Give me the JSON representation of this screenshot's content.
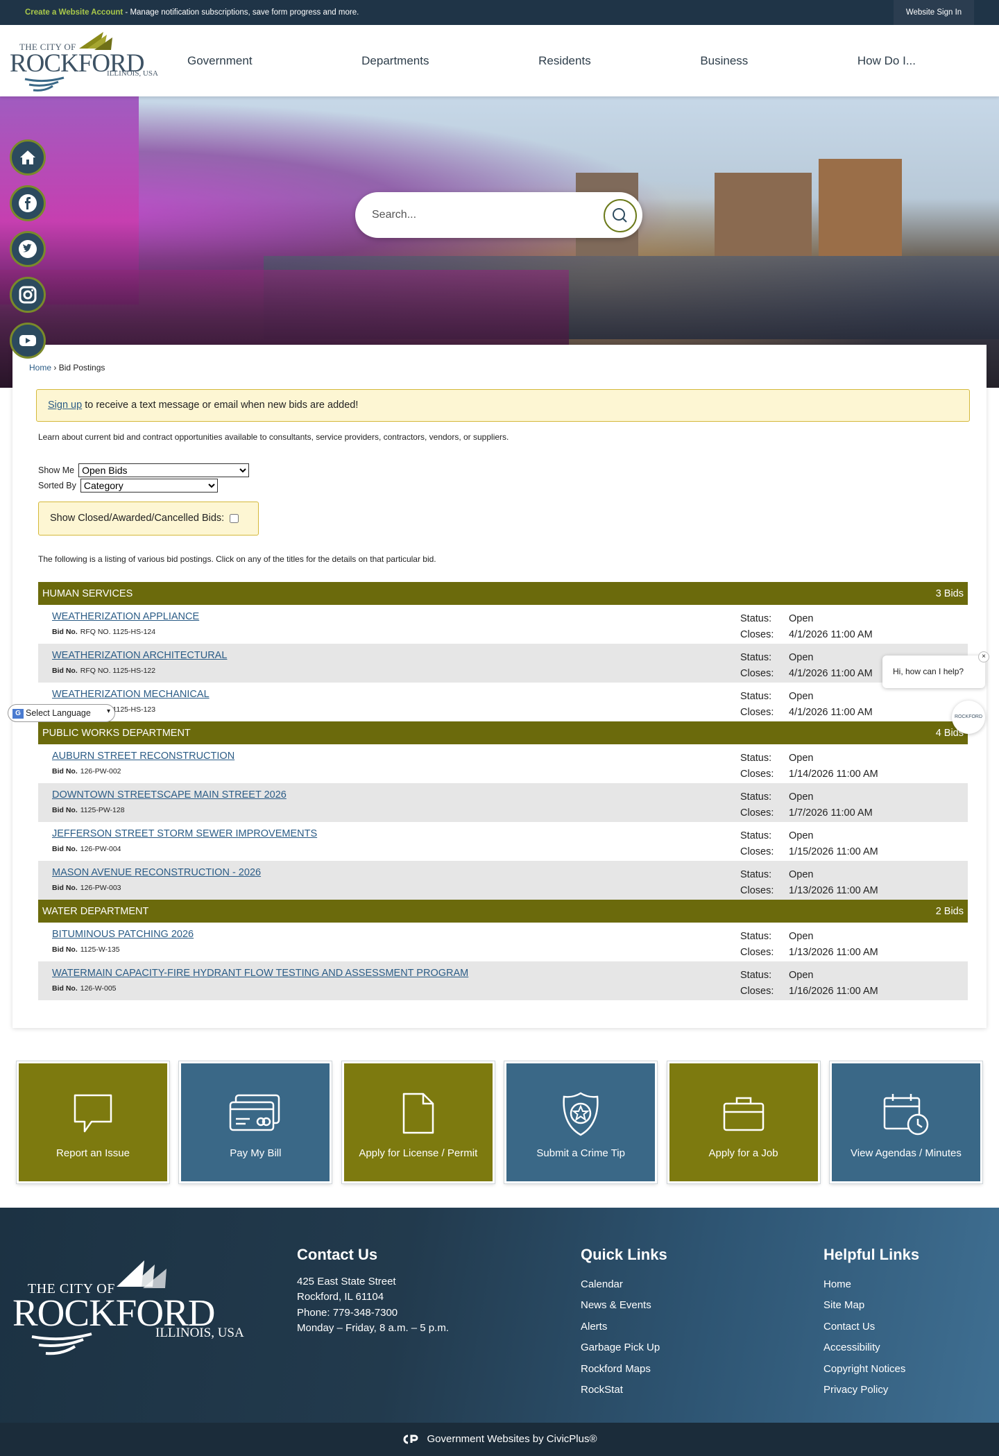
{
  "topbar": {
    "create_link": "Create a Website Account",
    "message": " - Manage notification subscriptions, save form progress and more.",
    "sign_in": "Website Sign In"
  },
  "logo": {
    "line1": "THE CITY OF",
    "line2": "ROCKFORD",
    "line3": "ILLINOIS, USA"
  },
  "nav": [
    "Government",
    "Departments",
    "Residents",
    "Business",
    "How Do I..."
  ],
  "search": {
    "placeholder": "Search..."
  },
  "social": [
    "home-icon",
    "facebook-icon",
    "twitter-icon",
    "instagram-icon",
    "youtube-icon"
  ],
  "breadcrumb": {
    "home": "Home",
    "separator": " › ",
    "current": "Bid Postings"
  },
  "alert": {
    "link": "Sign up",
    "text": " to receive a text message or email when new bids are added!"
  },
  "intro": "Learn about current bid and contract opportunities available to consultants, service providers, contractors, vendors, or suppliers.",
  "filters": {
    "show_me_label": "Show Me",
    "show_me_value": "Open Bids",
    "sorted_by_label": "Sorted By",
    "sorted_by_value": "Category",
    "closed_label": "Show Closed/Awarded/Cancelled Bids:"
  },
  "list_intro": "The following is a listing of various bid postings. Click on any of the titles for the details on that particular bid.",
  "labels": {
    "bid_no": "Bid No.",
    "status": "Status:",
    "closes": "Closes:"
  },
  "categories": [
    {
      "name": "HUMAN SERVICES",
      "count": "3 Bids",
      "bids": [
        {
          "title": "WEATHERIZATION APPLIANCE",
          "bid_no": "RFQ NO. 1125-HS-124",
          "status": "Open",
          "closes": "4/1/2026 11:00 AM"
        },
        {
          "title": "WEATHERIZATION ARCHITECTURAL",
          "bid_no": "RFQ NO. 1125-HS-122",
          "status": "Open",
          "closes": "4/1/2026 11:00 AM"
        },
        {
          "title": "WEATHERIZATION MECHANICAL",
          "bid_no": "RFQ NO. 1125-HS-123",
          "status": "Open",
          "closes": "4/1/2026 11:00 AM"
        }
      ]
    },
    {
      "name": "PUBLIC WORKS DEPARTMENT",
      "count": "4 Bids",
      "bids": [
        {
          "title": "AUBURN STREET RECONSTRUCTION",
          "bid_no": "126-PW-002",
          "status": "Open",
          "closes": "1/14/2026 11:00 AM"
        },
        {
          "title": "DOWNTOWN STREETSCAPE MAIN STREET 2026",
          "bid_no": "1125-PW-128",
          "status": "Open",
          "closes": "1/7/2026 11:00 AM"
        },
        {
          "title": "JEFFERSON STREET STORM SEWER IMPROVEMENTS",
          "bid_no": "126-PW-004",
          "status": "Open",
          "closes": "1/15/2026 11:00 AM"
        },
        {
          "title": "MASON AVENUE RECONSTRUCTION - 2026",
          "bid_no": "126-PW-003",
          "status": "Open",
          "closes": "1/13/2026 11:00 AM"
        }
      ]
    },
    {
      "name": "WATER DEPARTMENT",
      "count": "2 Bids",
      "bids": [
        {
          "title": "BITUMINOUS PATCHING 2026",
          "bid_no": "1125-W-135",
          "status": "Open",
          "closes": "1/13/2026 11:00 AM"
        },
        {
          "title": "WATERMAIN CAPACITY-FIRE HYDRANT FLOW TESTING AND ASSESSMENT PROGRAM",
          "bid_no": "126-W-005",
          "status": "Open",
          "closes": "1/16/2026 11:00 AM"
        }
      ]
    }
  ],
  "chat": {
    "greeting": "Hi, how can I help?",
    "close": "×",
    "bot_label": "ROCKFORD"
  },
  "translate": {
    "label": "Select Language"
  },
  "tiles": [
    {
      "label": "Report an Issue",
      "icon": "speech-bubble-icon",
      "color": "#7d7a0f"
    },
    {
      "label": "Pay My Bill",
      "icon": "credit-card-icon",
      "color": "#3a6887"
    },
    {
      "label": "Apply for License / Permit",
      "icon": "document-icon",
      "color": "#7d7a0f"
    },
    {
      "label": "Submit a Crime Tip",
      "icon": "police-badge-icon",
      "color": "#3a6887"
    },
    {
      "label": "Apply for a Job",
      "icon": "briefcase-icon",
      "color": "#7d7a0f"
    },
    {
      "label": "View Agendas / Minutes",
      "icon": "calendar-clock-icon",
      "color": "#3a6887"
    }
  ],
  "footer": {
    "logo": {
      "line1": "THE CITY OF",
      "line2": "ROCKFORD",
      "line3": "ILLINOIS, USA"
    },
    "contact": {
      "heading": "Contact Us",
      "lines": [
        "425 East State Street",
        "Rockford, IL 61104",
        "Phone: 779-348-7300",
        "Monday – Friday, 8 a.m. – 5 p.m."
      ]
    },
    "quick_links": {
      "heading": "Quick Links",
      "items": [
        "Calendar",
        "News & Events",
        "Alerts",
        "Garbage Pick Up",
        "Rockford Maps",
        "RockStat"
      ]
    },
    "helpful_links": {
      "heading": "Helpful Links",
      "items": [
        "Home",
        "Site Map",
        "Contact Us",
        "Accessibility",
        "Copyright Notices",
        "Privacy Policy"
      ]
    },
    "credit": "Government Websites by CivicPlus®"
  }
}
